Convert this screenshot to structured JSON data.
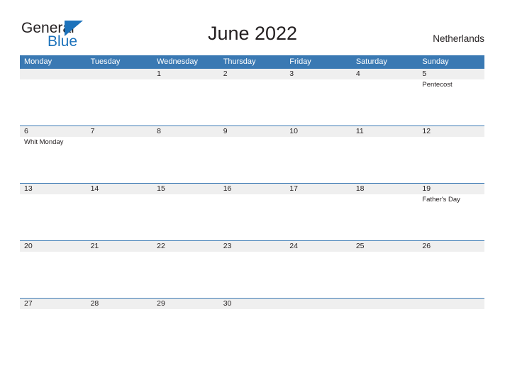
{
  "brand": {
    "word_one": "General",
    "word_two": "Blue",
    "flag_icon": "triangle-flag-icon",
    "primary_color": "#1c72bb"
  },
  "header": {
    "title": "June 2022",
    "country": "Netherlands"
  },
  "theme": {
    "header_blue": "#3a79b3",
    "band_grey": "#efefef",
    "text_color": "#231f20"
  },
  "calendar": {
    "weekday_headers": [
      "Monday",
      "Tuesday",
      "Wednesday",
      "Thursday",
      "Friday",
      "Saturday",
      "Sunday"
    ],
    "weeks": [
      [
        {
          "day": "",
          "events": []
        },
        {
          "day": "",
          "events": []
        },
        {
          "day": "1",
          "events": []
        },
        {
          "day": "2",
          "events": []
        },
        {
          "day": "3",
          "events": []
        },
        {
          "day": "4",
          "events": []
        },
        {
          "day": "5",
          "events": [
            "Pentecost"
          ]
        }
      ],
      [
        {
          "day": "6",
          "events": [
            "Whit Monday"
          ]
        },
        {
          "day": "7",
          "events": []
        },
        {
          "day": "8",
          "events": []
        },
        {
          "day": "9",
          "events": []
        },
        {
          "day": "10",
          "events": []
        },
        {
          "day": "11",
          "events": []
        },
        {
          "day": "12",
          "events": []
        }
      ],
      [
        {
          "day": "13",
          "events": []
        },
        {
          "day": "14",
          "events": []
        },
        {
          "day": "15",
          "events": []
        },
        {
          "day": "16",
          "events": []
        },
        {
          "day": "17",
          "events": []
        },
        {
          "day": "18",
          "events": []
        },
        {
          "day": "19",
          "events": [
            "Father's Day"
          ]
        }
      ],
      [
        {
          "day": "20",
          "events": []
        },
        {
          "day": "21",
          "events": []
        },
        {
          "day": "22",
          "events": []
        },
        {
          "day": "23",
          "events": []
        },
        {
          "day": "24",
          "events": []
        },
        {
          "day": "25",
          "events": []
        },
        {
          "day": "26",
          "events": []
        }
      ],
      [
        {
          "day": "27",
          "events": []
        },
        {
          "day": "28",
          "events": []
        },
        {
          "day": "29",
          "events": []
        },
        {
          "day": "30",
          "events": []
        },
        {
          "day": "",
          "events": []
        },
        {
          "day": "",
          "events": []
        },
        {
          "day": "",
          "events": []
        }
      ]
    ]
  }
}
